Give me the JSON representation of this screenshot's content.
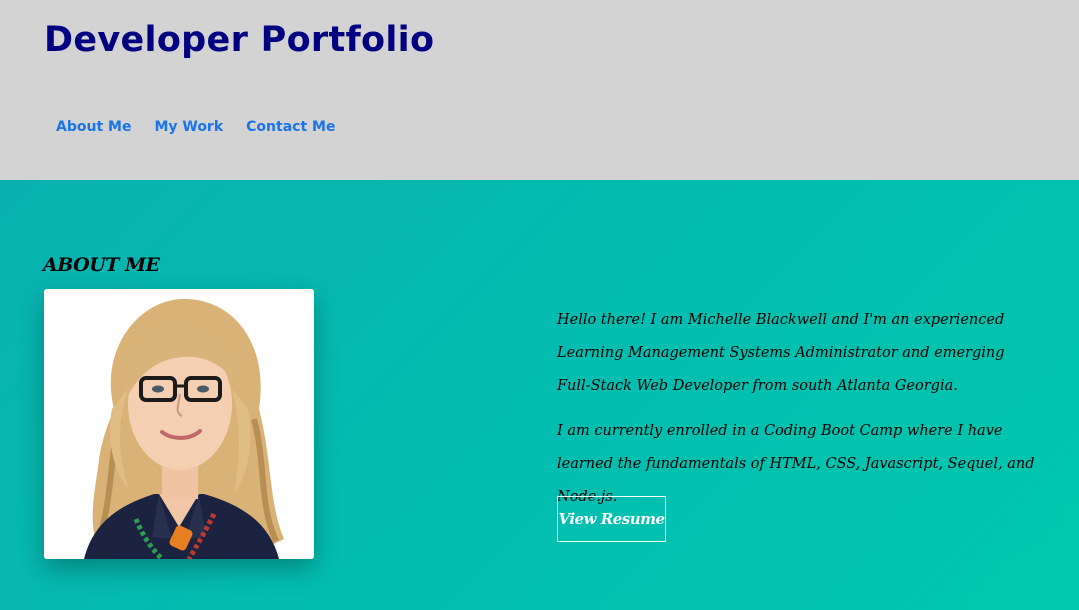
{
  "header": {
    "title": "Developer Portfolio",
    "nav": [
      "About Me",
      "My Work",
      "Contact Me"
    ]
  },
  "about": {
    "heading": "ABOUT ME",
    "paragraphs": [
      "Hello there! I am Michelle Blackwell and I'm an experienced Learning Management Systems Administrator and emerging Full-Stack Web Developer from south Atlanta Georgia.",
      "I am currently enrolled in a Coding Boot Camp where I have learned the fundamentals of HTML, CSS, Javascript, Sequel, and Node.js."
    ],
    "resume_label": "View Resume"
  },
  "colors": {
    "header_bg": "#d3d3d3",
    "title": "#000080",
    "nav_link": "#1a73e8",
    "section_bg": "#02bfb0"
  }
}
